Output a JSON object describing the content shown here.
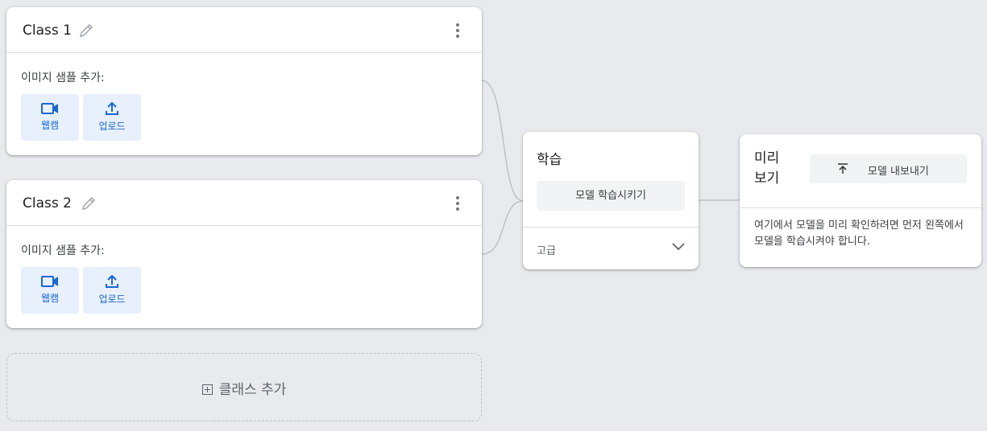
{
  "classes": [
    {
      "name": "Class 1",
      "sample_label": "이미지 샘플 추가:",
      "webcam_label": "웹캠",
      "upload_label": "업로드"
    },
    {
      "name": "Class 2",
      "sample_label": "이미지 샘플 추가:",
      "webcam_label": "웹캠",
      "upload_label": "업로드"
    }
  ],
  "add_class": {
    "label": "클래스 추가"
  },
  "training": {
    "title": "학습",
    "train_button": "모델 학습시키기",
    "advanced_label": "고급"
  },
  "preview": {
    "title_line1": "미리",
    "title_line2": "보기",
    "export_button": "모델 내보내기",
    "message": "여기에서 모델을 미리 확인하려면 먼저 왼쪽에서 모델을 학습시켜야 합니다."
  },
  "icons": {
    "edit": "pencil-icon",
    "menu": "more-vert-icon",
    "webcam": "videocam-icon",
    "upload": "upload-icon",
    "add": "add-box-icon",
    "expand": "chevron-down-icon",
    "export": "export-icon"
  },
  "colors": {
    "background": "#e8eaed",
    "accent": "#1967d2",
    "accent_bg": "#e8f0fe"
  }
}
